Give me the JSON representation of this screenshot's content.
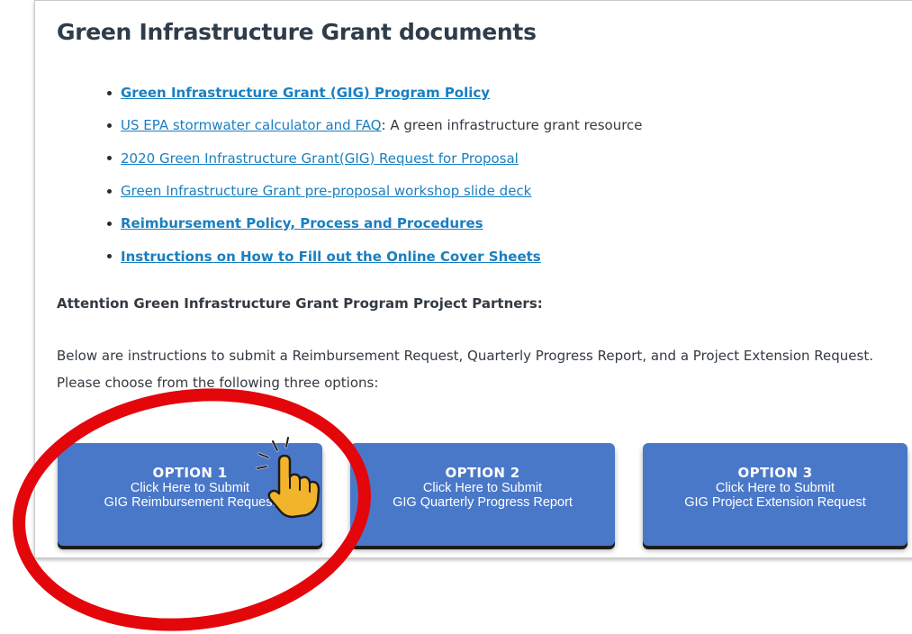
{
  "page": {
    "title": "Green Infrastructure Grant documents"
  },
  "documents": [
    {
      "link": "Green Infrastructure Grant (GIG) Program Policy",
      "suffix": "",
      "bold": true
    },
    {
      "link": "US EPA stormwater calculator and FAQ",
      "suffix": ": A green infrastructure grant resource",
      "bold": false
    },
    {
      "link": "2020 Green Infrastructure Grant(GIG) Request for Proposal",
      "suffix": "",
      "bold": false
    },
    {
      "link": "Green Infrastructure Grant pre-proposal workshop slide deck",
      "suffix": "",
      "bold": false
    },
    {
      "link": "Reimbursement Policy, Process and Procedures",
      "suffix": "",
      "bold": true
    },
    {
      "link": "Instructions on How to Fill out the Online Cover Sheets",
      "suffix": "",
      "bold": true
    }
  ],
  "attention": "Attention Green Infrastructure Grant Program Project Partners:",
  "instructions": "Below are instructions to submit a Reimbursement Request, Quarterly Progress Report, and a Project Extension Request. Please choose from the following three options:",
  "options": [
    {
      "title": "OPTION 1",
      "line1": "Click Here to Submit",
      "line2": "GIG Reimbursement Request"
    },
    {
      "title": "OPTION 2",
      "line1": "Click Here to Submit",
      "line2": "GIG Quarterly Progress Report"
    },
    {
      "title": "OPTION 3",
      "line1": "Click Here to Submit",
      "line2": "GIG Project Extension Request"
    }
  ],
  "annotation": {
    "circle_color": "#e3060b",
    "cursor_icon": "pointing-hand-icon"
  },
  "colors": {
    "link": "#1a7fc0",
    "button": "#4a78c9",
    "heading": "#2f3c4a"
  }
}
